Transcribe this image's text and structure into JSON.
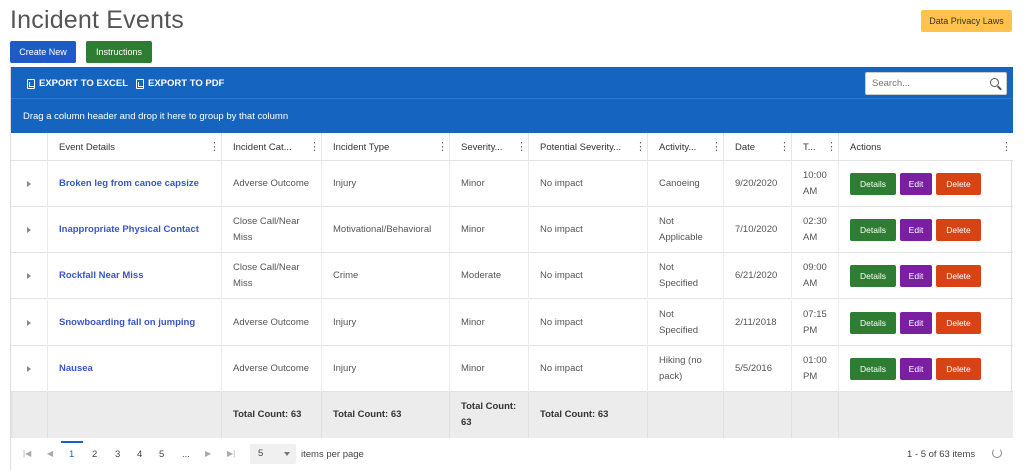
{
  "page": {
    "title": "Incident Events",
    "create_label": "Create New",
    "instructions_label": "Instructions",
    "privacy_label": "Data Privacy Laws"
  },
  "toolbar": {
    "export_excel": "EXPORT TO EXCEL",
    "export_pdf": "EXPORT TO PDF",
    "search_placeholder": "Search..."
  },
  "group_hint": "Drag a column header and drop it here to group by that column",
  "columns": [
    "Event Details",
    "Incident Cat...",
    "Incident Type",
    "Severity...",
    "Potential Severity...",
    "Activity...",
    "Date",
    "T...",
    "Actions"
  ],
  "rows": [
    {
      "event": "Broken leg from canoe capsize",
      "category": "Adverse Outcome",
      "type": "Injury",
      "severity": "Minor",
      "potential": "No impact",
      "activity": "Canoeing",
      "date": "9/20/2020",
      "time": "10:00 AM"
    },
    {
      "event": "Inappropriate Physical Contact",
      "category": "Close Call/Near Miss",
      "type": "Motivational/Behavioral",
      "severity": "Minor",
      "potential": "No impact",
      "activity": "Not Applicable",
      "date": "7/10/2020",
      "time": "02:30 AM"
    },
    {
      "event": "Rockfall Near Miss",
      "category": "Close Call/Near Miss",
      "type": "Crime",
      "severity": "Moderate",
      "potential": "No impact",
      "activity": "Not Specified",
      "date": "6/21/2020",
      "time": "09:00 AM"
    },
    {
      "event": "Snowboarding fall on jumping",
      "category": "Adverse Outcome",
      "type": "Injury",
      "severity": "Minor",
      "potential": "No impact",
      "activity": "Not Specified",
      "date": "2/11/2018",
      "time": "07:15 PM"
    },
    {
      "event": "Nausea",
      "category": "Adverse Outcome",
      "type": "Injury",
      "severity": "Minor",
      "potential": "No impact",
      "activity": "Hiking (no pack)",
      "date": "5/5/2016",
      "time": "01:00 PM"
    }
  ],
  "actions": {
    "details": "Details",
    "edit": "Edit",
    "delete": "Delete"
  },
  "totals": {
    "category": "Total Count: 63",
    "type": "Total Count: 63",
    "severity": "Total Count: 63",
    "potential": "Total Count: 63"
  },
  "pager": {
    "pages": [
      "1",
      "2",
      "3",
      "4",
      "5",
      "..."
    ],
    "current": "1",
    "per_page": "5",
    "per_page_label": "items per page",
    "range": "1 - 5 of 63 items"
  },
  "colors": {
    "primary": "#1565c0",
    "green": "#2e7d32",
    "purple": "#7b1fa2",
    "orange": "#d84315",
    "amber": "#ffc34d"
  },
  "icons": [
    "excel-icon",
    "pdf-icon",
    "search-icon",
    "expand-icon",
    "more-icon",
    "refresh-icon"
  ]
}
